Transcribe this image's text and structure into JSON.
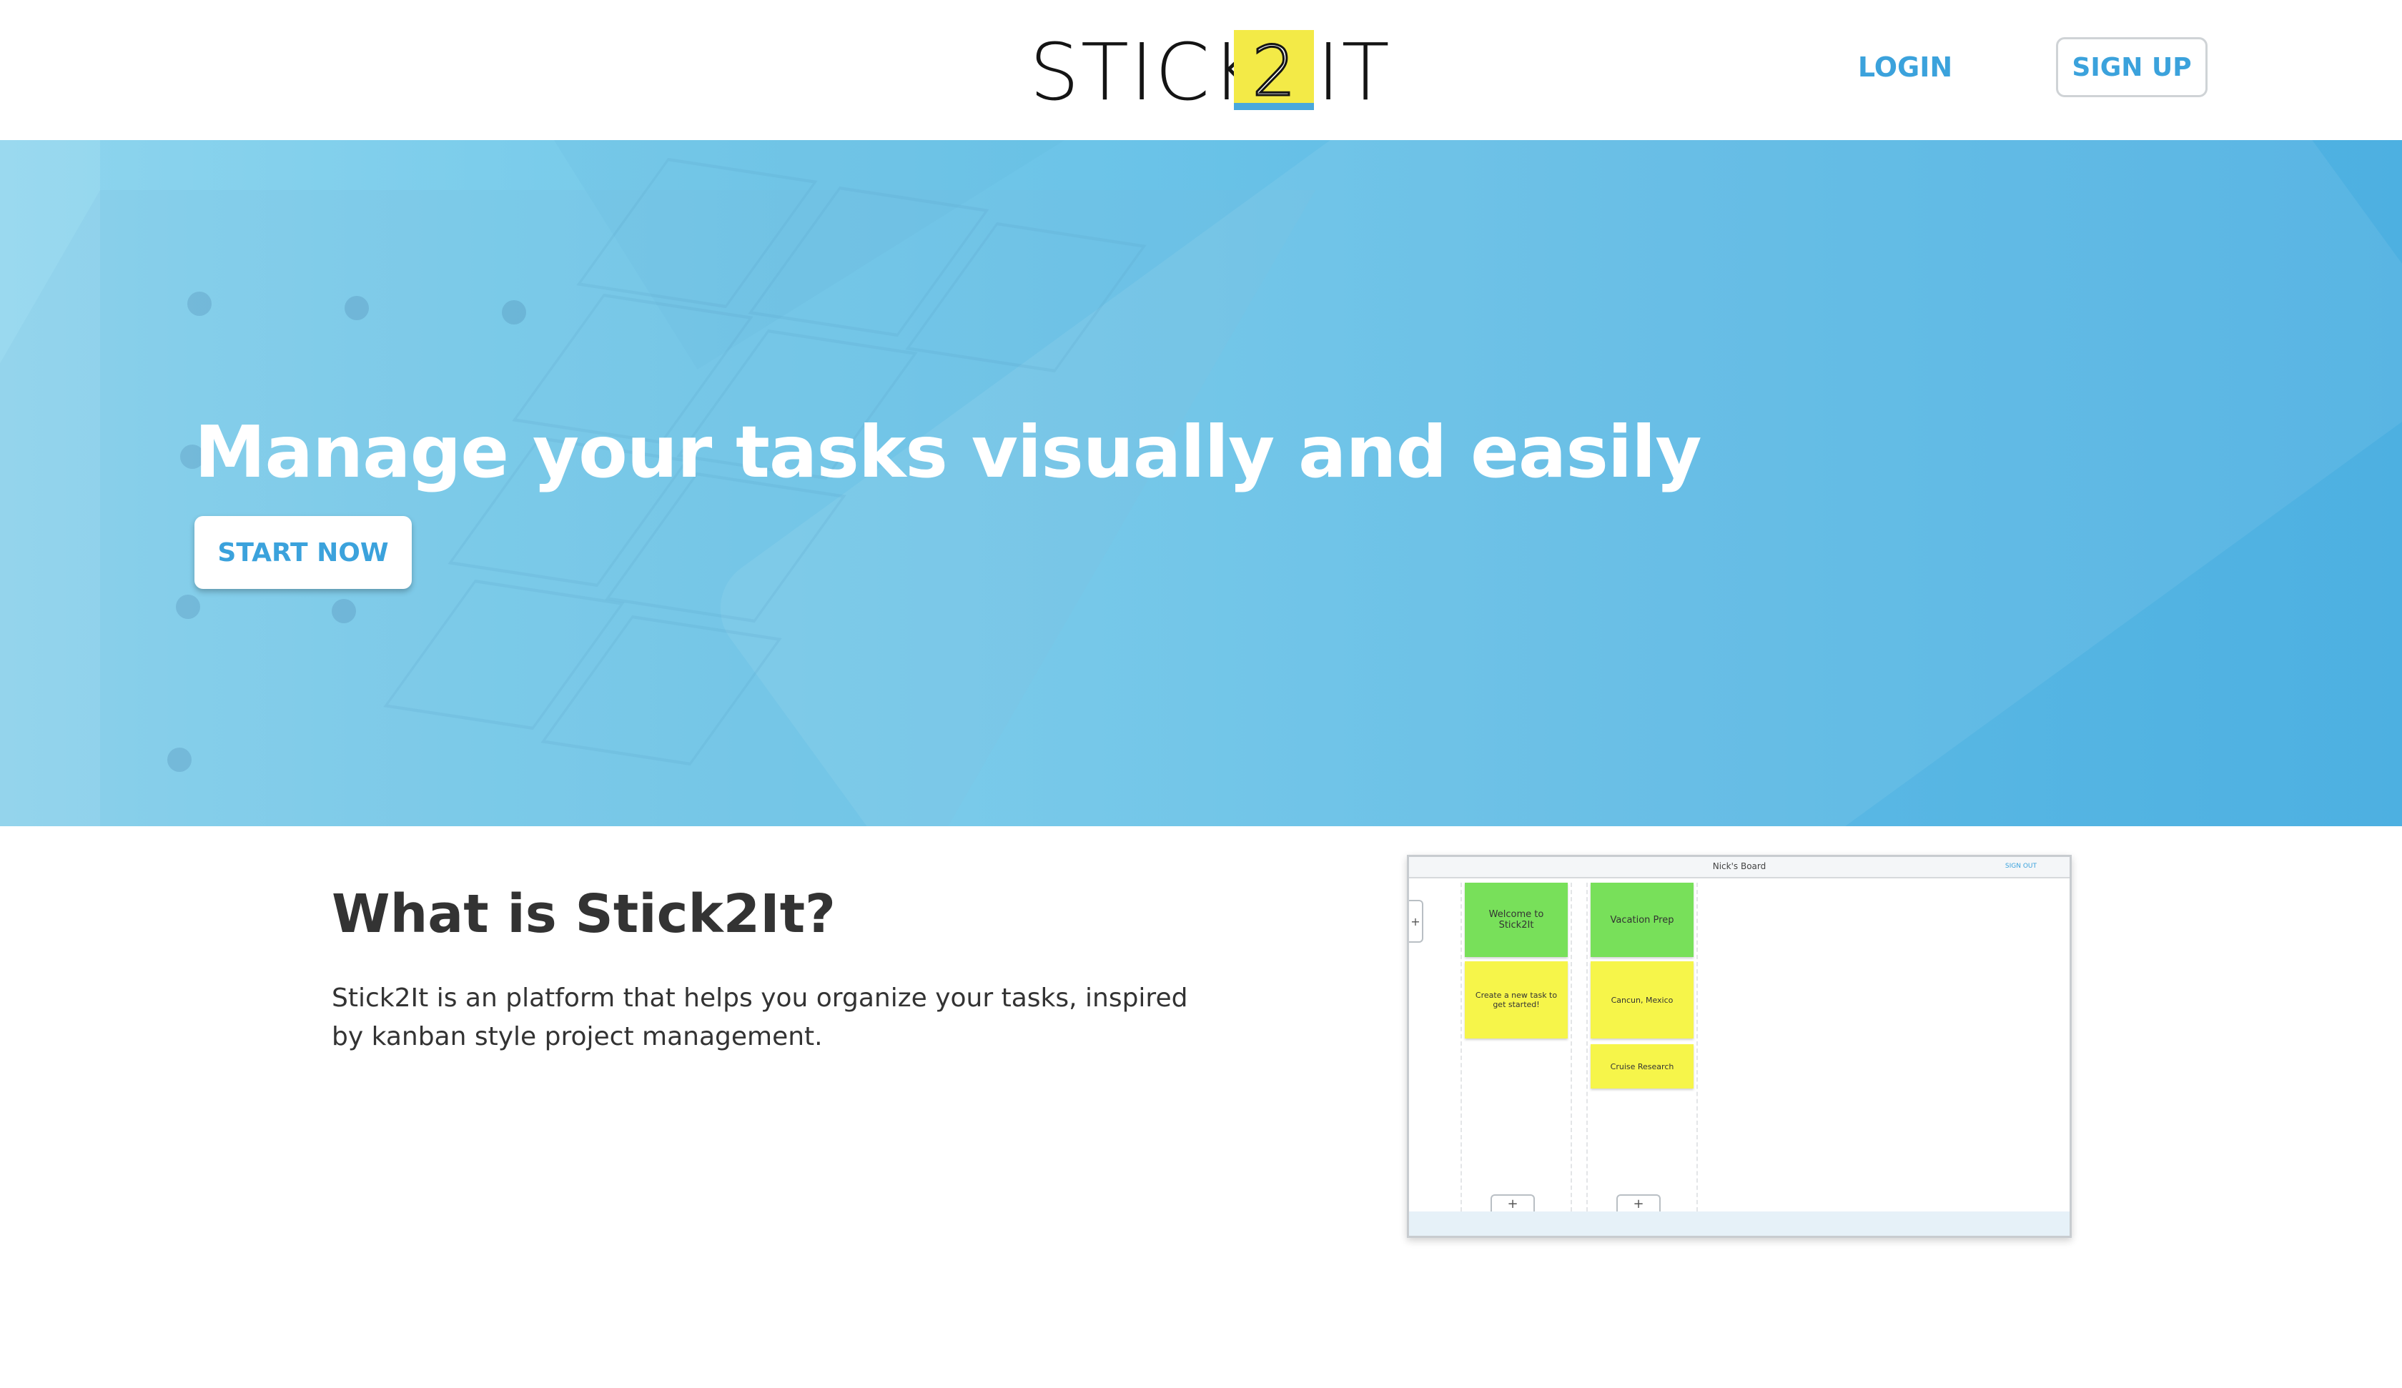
{
  "header": {
    "logo": {
      "left": "STICK",
      "badge": "2",
      "right": "IT"
    },
    "login_label": "LOGIN",
    "signup_label": "SIGN UP"
  },
  "hero": {
    "title": "Manage your tasks visually and easily",
    "cta_label": "START NOW"
  },
  "about": {
    "title": "What is Stick2It?",
    "text": "Stick2It is an platform that helps you organize your tasks, inspired by kanban style project management."
  },
  "preview": {
    "board_title": "Nick's Board",
    "signout_label": "SIGN OUT",
    "add_board_symbol": "+",
    "columns": [
      {
        "cards": [
          {
            "text": "Welcome to Stick2It",
            "color": "green"
          },
          {
            "text": "Create a new task to get started!",
            "color": "yellow"
          }
        ],
        "add_symbol": "+"
      },
      {
        "cards": [
          {
            "text": "Vacation Prep",
            "color": "green"
          },
          {
            "text": "Cancun, Mexico",
            "color": "yellow"
          },
          {
            "text": "Cruise Research",
            "color": "yellow"
          }
        ],
        "add_symbol": "+"
      }
    ]
  },
  "colors": {
    "accent": "#3ba2dc",
    "logo_note": "#f3ea47",
    "card_green": "#78e05a",
    "card_yellow": "#f6f54a"
  }
}
